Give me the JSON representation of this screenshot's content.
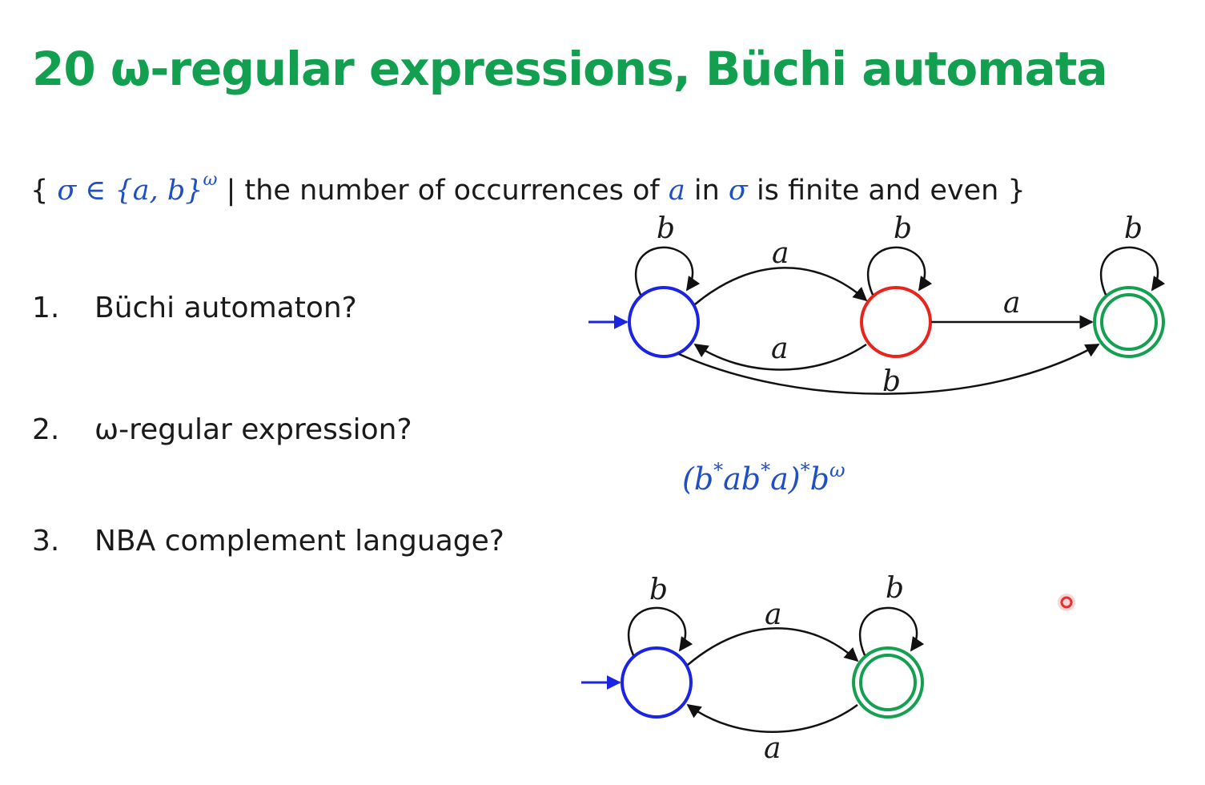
{
  "slide": {
    "title": "20 ω-regular expressions, Büchi automata",
    "set_definition": {
      "open": "{ ",
      "math_left": "σ ∈ {a, b}",
      "omega": "ω",
      "bar_text": " | the number of occurrences of ",
      "var_a": "a",
      "in_text": " in ",
      "var_sigma": "σ",
      "rest": " is finite and even }"
    },
    "questions": [
      {
        "num": "1.",
        "text": "Büchi automaton?"
      },
      {
        "num": "2.",
        "text": "ω-regular expression?"
      },
      {
        "num": "3.",
        "text": "NBA complement language?"
      }
    ],
    "expression": {
      "p1": "(b",
      "s1": "*",
      "p2": "ab",
      "s2": "*",
      "p3": "a)",
      "s3": "*",
      "p4": "b",
      "s4": "ω"
    },
    "automaton1": {
      "self_loop_labels": [
        "b",
        "b",
        "b"
      ],
      "edge_labels": {
        "q0_to_q1": "a",
        "q1_to_q0": "a",
        "q1_to_q2": "a",
        "q0_to_q2": "b"
      }
    },
    "automaton2": {
      "self_loop_labels": [
        "b",
        "b"
      ],
      "edge_labels": {
        "p0_to_p1": "a",
        "p1_to_p0": "a"
      }
    },
    "colors": {
      "title": "#12a050",
      "math": "#1f4fc4",
      "initial_state": "#1b24e0",
      "middle_state": "#e8241c",
      "accepting_state": "#14a050",
      "arrow": "#111111",
      "pointer": "#e53030"
    }
  }
}
